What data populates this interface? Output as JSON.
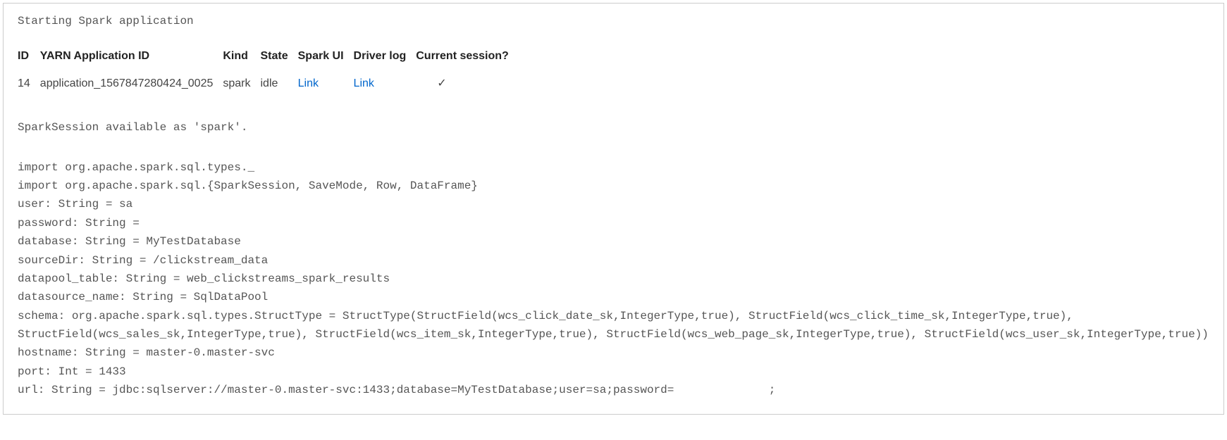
{
  "status": "Starting Spark application",
  "table": {
    "headers": {
      "id": "ID",
      "yarn": "YARN Application ID",
      "kind": "Kind",
      "state": "State",
      "sparkui": "Spark UI",
      "driverlog": "Driver log",
      "current": "Current session?"
    },
    "row": {
      "id": "14",
      "yarn": "application_1567847280424_0025",
      "kind": "spark",
      "state": "idle",
      "sparkui": "Link",
      "driverlog": "Link",
      "current": "✓"
    }
  },
  "session_available": "SparkSession available as 'spark'.",
  "code_output": "import org.apache.spark.sql.types._\nimport org.apache.spark.sql.{SparkSession, SaveMode, Row, DataFrame}\nuser: String = sa\npassword: String =\ndatabase: String = MyTestDatabase\nsourceDir: String = /clickstream_data\ndatapool_table: String = web_clickstreams_spark_results\ndatasource_name: String = SqlDataPool\nschema: org.apache.spark.sql.types.StructType = StructType(StructField(wcs_click_date_sk,IntegerType,true), StructField(wcs_click_time_sk,IntegerType,true), StructField(wcs_sales_sk,IntegerType,true), StructField(wcs_item_sk,IntegerType,true), StructField(wcs_web_page_sk,IntegerType,true), StructField(wcs_user_sk,IntegerType,true))\nhostname: String = master-0.master-svc\nport: Int = 1433\nurl: String = jdbc:sqlserver://master-0.master-svc:1433;database=MyTestDatabase;user=sa;password=              ;"
}
